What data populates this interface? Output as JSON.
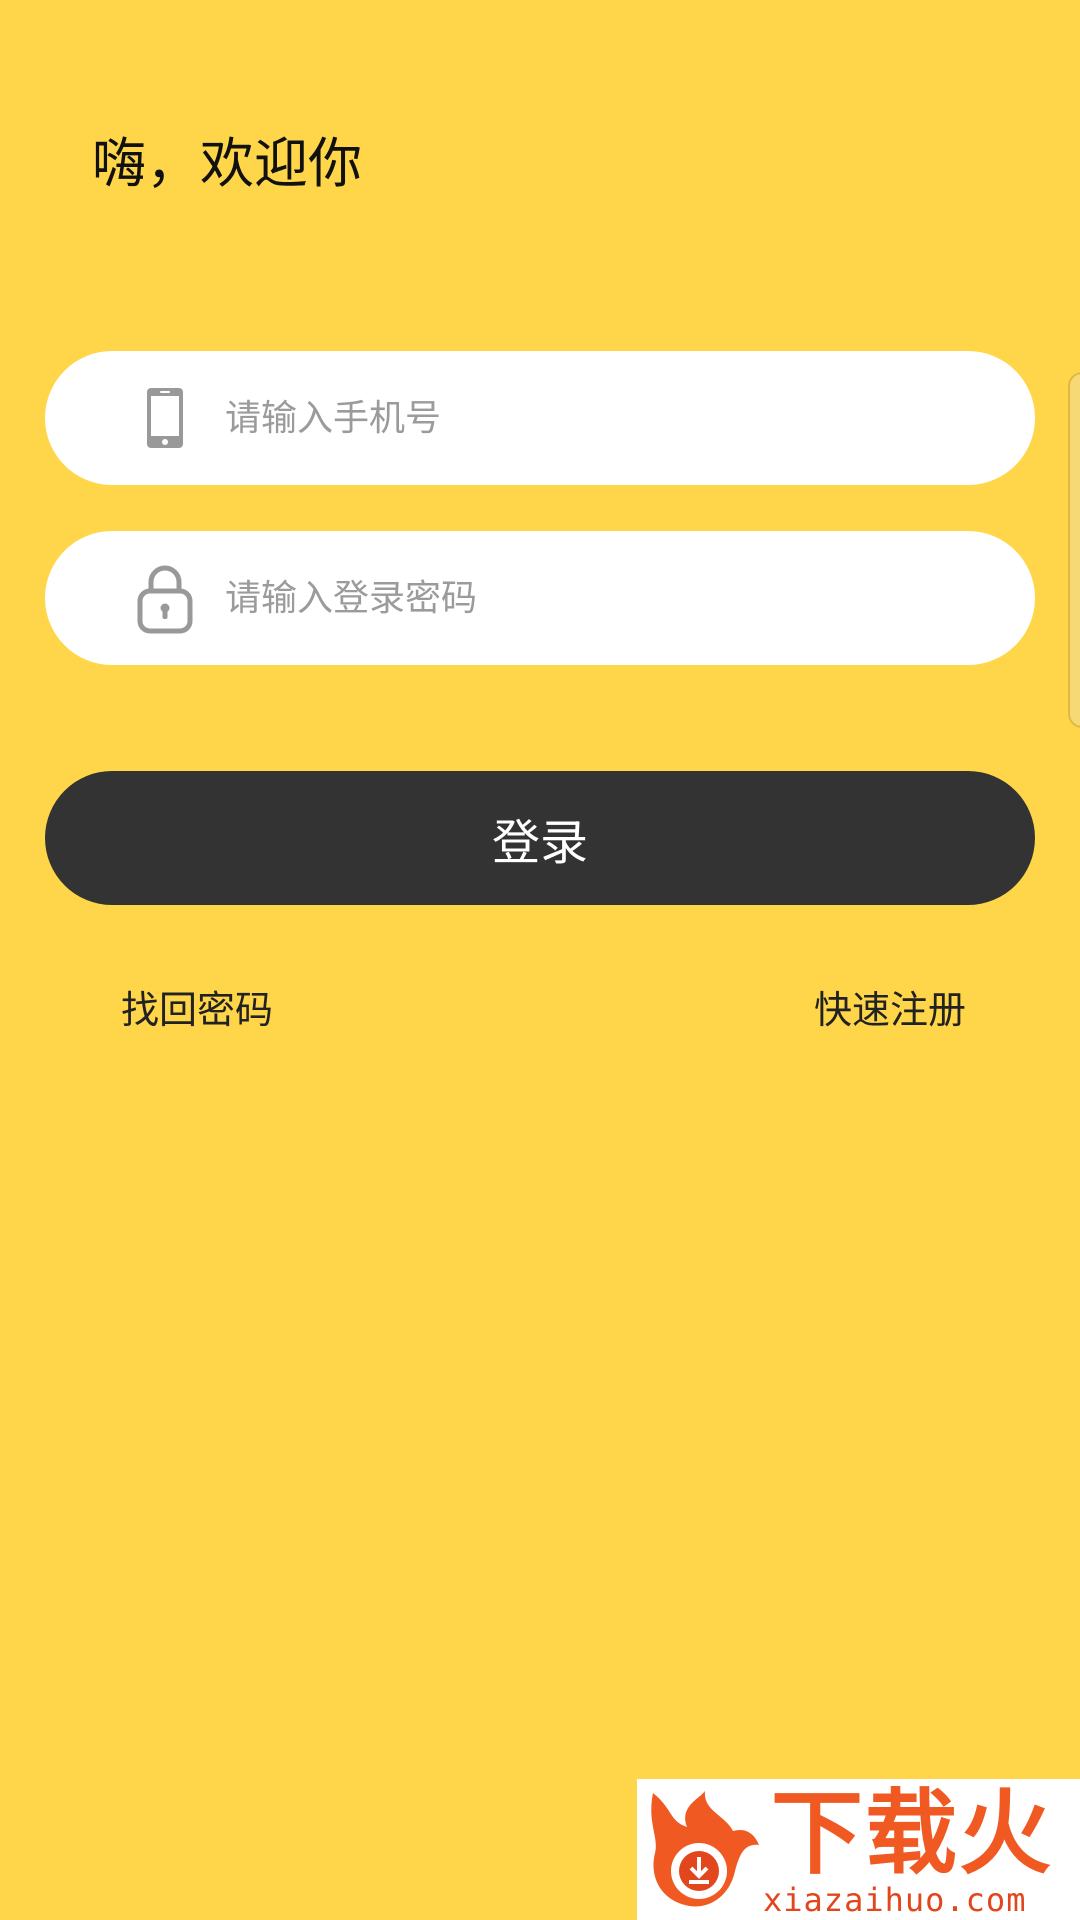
{
  "greeting": "嗨，欢迎你",
  "phone_field": {
    "icon": "smartphone-icon",
    "placeholder": "请输入手机号",
    "value": ""
  },
  "password_field": {
    "icon": "lock-icon",
    "placeholder": "请输入登录密码",
    "value": ""
  },
  "login_button": {
    "label": "登录"
  },
  "links": {
    "forgot_password": "找回密码",
    "quick_register": "快速注册"
  },
  "watermark": {
    "title": "下载火",
    "url": "xiazaihuo.com"
  },
  "colors": {
    "background": "#FFD649",
    "button": "#333333",
    "button_text": "#FFFFFF",
    "field": "#FFFFFF",
    "placeholder": "#9B9B9B",
    "watermark_accent": "#F05A22"
  }
}
